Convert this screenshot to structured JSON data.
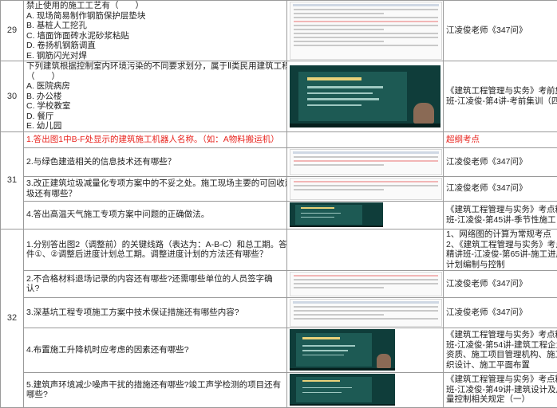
{
  "rows": [
    {
      "num": "29",
      "question_lines": [
        "禁止使用的施工工艺有（　　）",
        "A. 现场简易制作钢筋保护层垫块",
        "B. 基桩人工挖孔",
        "C. 墙面饰面砖水泥砂浆粘贴",
        "D. 卷扬机钢筋调直",
        "E. 钢筋闪光对焊"
      ],
      "thumb": "doc",
      "source_lines": [
        "江凌俊老师《347问》"
      ]
    },
    {
      "num": "30",
      "question_lines": [
        "下列建筑根据控制室内环境污染的不同要求划分，属于Ⅱ类民用建筑工程的有",
        "（　　）",
        "A. 医院病房",
        "B. 办公楼",
        "C. 学校教室",
        "D. 餐厅",
        "E. 幼儿园"
      ],
      "thumb": "vid",
      "source_lines": [
        "《建筑工程管理与实务》考前集训",
        "班-江凌俊-第4讲-考前集训（四）"
      ]
    },
    {
      "num": "31",
      "sub": [
        {
          "question": "1.答出图1中B-F处显示的建筑施工机器人名称。（如：A物料搬运机）",
          "red": true,
          "thumb": "blank",
          "source": "超纲考点",
          "source_red": true
        },
        {
          "question": "2.与绿色建造相关的信息技术还有哪些？",
          "thumb": "doc",
          "source": "江凌俊老师《347问》"
        },
        {
          "question_lines": [
            "3.改正建筑垃圾减量化专项方案中的不妥之处。施工现场主要的可回收建筑垃",
            "圾还有哪些？"
          ],
          "thumb": "doc",
          "source": "江凌俊老师《347问》"
        },
        {
          "question": "4.答出高温天气施工专项方案中问题的正确做法。",
          "thumb": "vid",
          "source_lines": [
            "《建筑工程管理与实务》考点精讲",
            "班-江凌俊-第45讲-季节性施工"
          ]
        }
      ]
    },
    {
      "num": "32",
      "sub": [
        {
          "question_lines": [
            "1.分别答出图2（调整前）的关键线路（表达为：A-B-C）和总工期。答出因事",
            "件①、②调整后进度计划总工期。调整进度计划的方法还有哪些？"
          ],
          "thumb": "blank",
          "source_lines": [
            "1、网络图的计算为常规考点",
            "2、《建筑工程管理与实务》考点",
            "精讲班-江凌俊-第65讲-施工进度",
            "计划编制与控制"
          ]
        },
        {
          "question": "2.不合格材料退场记录的内容还有哪些?还需哪些单位的人员签字确认?",
          "thumb": "doc",
          "source": "江凌俊老师《347问》"
        },
        {
          "question": "3.深基坑工程专项施工方案中技术保证措施还有哪些内容?",
          "thumb": "doc",
          "source": "江凌俊老师《347问》"
        },
        {
          "question": "4.布置施工升降机时应考虑的因素还有哪些?",
          "thumb": "vid",
          "source_lines": [
            "《建筑工程管理与实务》考点精讲",
            "班-江凌俊-第54讲-建筑工程企业",
            "资质、施工项目管理机构、施工组",
            "织设计、施工平面布置"
          ]
        },
        {
          "question": "5.建筑声环境减少噪声干扰的措施还有哪些?竣工声学检测的项目还有哪些?",
          "thumb": "vid",
          "source_lines": [
            "《建筑工程管理与实务》考点精讲",
            "班-江凌俊-第49讲-建筑设计及质",
            "量控制相关规定（一）"
          ]
        }
      ]
    }
  ]
}
